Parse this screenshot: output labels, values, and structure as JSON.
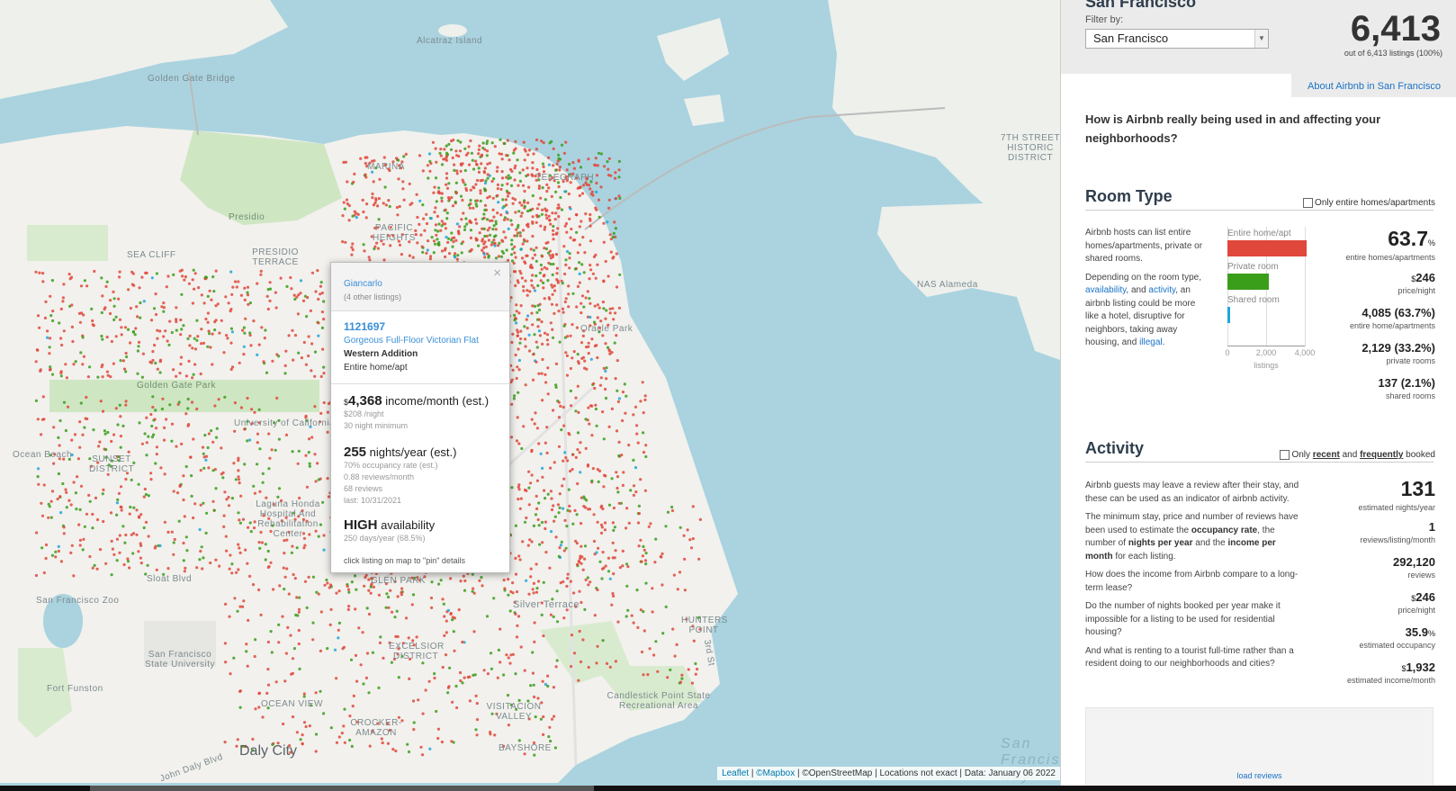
{
  "map": {
    "labels": {
      "alcatraz": "Alcatraz Island",
      "golden_gate_bridge": "Golden Gate Bridge",
      "presidio": "Presidio",
      "sea_cliff": "SEA CLIFF",
      "presidio_terrace": "PRESIDIO TERRACE",
      "golden_gate_park": "Golden Gate Park",
      "ocean_beach": "Ocean Beach",
      "sunset_district": "SUNSET DISTRICT",
      "laguna_honda": "Laguna Honda Hospital And Rehabilitation Center",
      "sf_zoo": "San Francisco Zoo",
      "sfsu": "San Francisco State University",
      "fort_funston": "Fort Funston",
      "daly_city": "Daly City",
      "nas_alameda": "NAS Alameda",
      "oracle_park": "Oracle Park",
      "silver_terrace": "Silver Terrace",
      "hunters_point": "HUNTERS POINT",
      "candlestick": "Candlestick Point State Recreational Area",
      "visitacion_valley": "VISITACION VALLEY",
      "bayshore": "BAYSHORE",
      "crocker_amazon": "CROCKER-AMAZON",
      "ocean_view": "OCEAN VIEW",
      "excelsior": "EXCELSIOR DISTRICT",
      "glen_park": "GLEN PARK",
      "seventh_street": "7TH STREET HISTORIC DISTRICT",
      "san_francisco_bay": "San Francisco Bay",
      "university_of_california": "University of California",
      "sloat_blvd": "Sloat Blvd",
      "john_daly_blvd": "John Daly Blvd",
      "third_st": "3rd St",
      "marina": "MARINA",
      "pacific_heights": "PACIFIC HEIGHTS",
      "telegraph": "TELEGRAPH"
    },
    "attribution": {
      "leaflet": "Leaflet",
      "mapbox": "©Mapbox",
      "osm": "©OpenStreetMap",
      "note": "Locations not exact",
      "data": "Data: January 06 2022"
    },
    "dot_colors": {
      "entire_home": "#e0483b",
      "private_room": "#3a9e1b",
      "shared_room": "#1fa6dc"
    }
  },
  "popup": {
    "host_name": "Giancarlo",
    "other_listings": "(4 other listings)",
    "close": "×",
    "listing_id": "1121697",
    "listing_name": "Gorgeous Full-Floor Victorian Flat",
    "neighbourhood": "Western Addition",
    "room_type": "Entire home/apt",
    "income_prefix": "$",
    "income_value": "4,368",
    "income_label": "income/month (est.)",
    "price_night": "$208 /night",
    "min_nights": "30 night minimum",
    "nights_value": "255",
    "nights_label": "nights/year (est.)",
    "occupancy": "70% occupancy rate (est.)",
    "reviews_month": "0.88 reviews/month",
    "reviews_count": "68 reviews",
    "last_review": "last: 10/31/2021",
    "availability_value": "HIGH",
    "availability_label": "availability",
    "availability_detail": "250 days/year (68.5%)",
    "hint": "click listing on map to \"pin\" details"
  },
  "panel": {
    "city": "San Francisco",
    "filter_label": "Filter by:",
    "filter_value": "San Francisco",
    "total": "6,413",
    "total_sub": "out of 6,413 listings (100%)",
    "about_link": "About Airbnb in San Francisco",
    "intro": "How is Airbnb really being used in and affecting your neighborhoods?",
    "room_type": {
      "title": "Room Type",
      "checkbox_label": "Only entire homes/apartments",
      "desc1": "Airbnb hosts can list entire homes/apartments, private or shared rooms.",
      "desc2_a": "Depending on the room type, ",
      "desc2_link1": "availability",
      "desc2_b": ", and ",
      "desc2_link2": "activity",
      "desc2_c": ", an airbnb listing could be more like a hotel, disruptive for neighbors, taking away housing, and ",
      "desc2_link3": "illegal",
      "desc2_d": ".",
      "chart": {
        "type": "bar",
        "categories": [
          "Entire home/apt",
          "Private room",
          "Shared room"
        ],
        "values": [
          4085,
          2129,
          137
        ],
        "colors": [
          "#e0483b",
          "#3a9e1b",
          "#1fa6dc"
        ],
        "xlabel": "listings",
        "xticks": [
          "0",
          "2,000",
          "4,000"
        ],
        "xlim": [
          0,
          4000
        ]
      },
      "stats": {
        "pct_entire": "63.7",
        "pct_symbol": "%",
        "pct_entire_label": "entire homes/apartments",
        "price": "246",
        "price_label": "price/night",
        "entire_count": "4,085 (63.7%)",
        "entire_label": "entire home/apartments",
        "private_count": "2,129 (33.2%)",
        "private_label": "private rooms",
        "shared_count": "137 (2.1%)",
        "shared_label": "shared rooms"
      }
    },
    "activity": {
      "title": "Activity",
      "checkbox_pre": "Only ",
      "checkbox_recent": "recent",
      "checkbox_mid": " and ",
      "checkbox_frequently": "frequently",
      "checkbox_post": " booked",
      "desc1": "Airbnb guests may leave a review after their stay, and these can be used as an indicator of airbnb activity.",
      "desc2_a": "The minimum stay, price and number of reviews have been used to estimate the ",
      "desc2_b1": "occupancy rate",
      "desc2_c": ", the number of ",
      "desc2_b2": "nights per year",
      "desc2_d": " and the ",
      "desc2_b3": "income per month",
      "desc2_e": " for each listing.",
      "desc3": "How does the income from Airbnb compare to a long-term lease?",
      "desc4": "Do the number of nights booked per year make it impossible for a listing to be used for residential housing?",
      "desc5": "And what is renting to a tourist full-time rather than a resident doing to our neighborhoods and cities?",
      "stats": {
        "nights": "131",
        "nights_label": "estimated nights/year",
        "reviews_per": "1",
        "reviews_per_label": "reviews/listing/month",
        "reviews": "292,120",
        "reviews_label": "reviews",
        "price": "246",
        "price_label": "price/night",
        "occupancy": "35.9",
        "occupancy_label": "estimated occupancy",
        "income": "1,932",
        "income_label": "estimated income/month"
      },
      "load_reviews": "load reviews"
    }
  }
}
